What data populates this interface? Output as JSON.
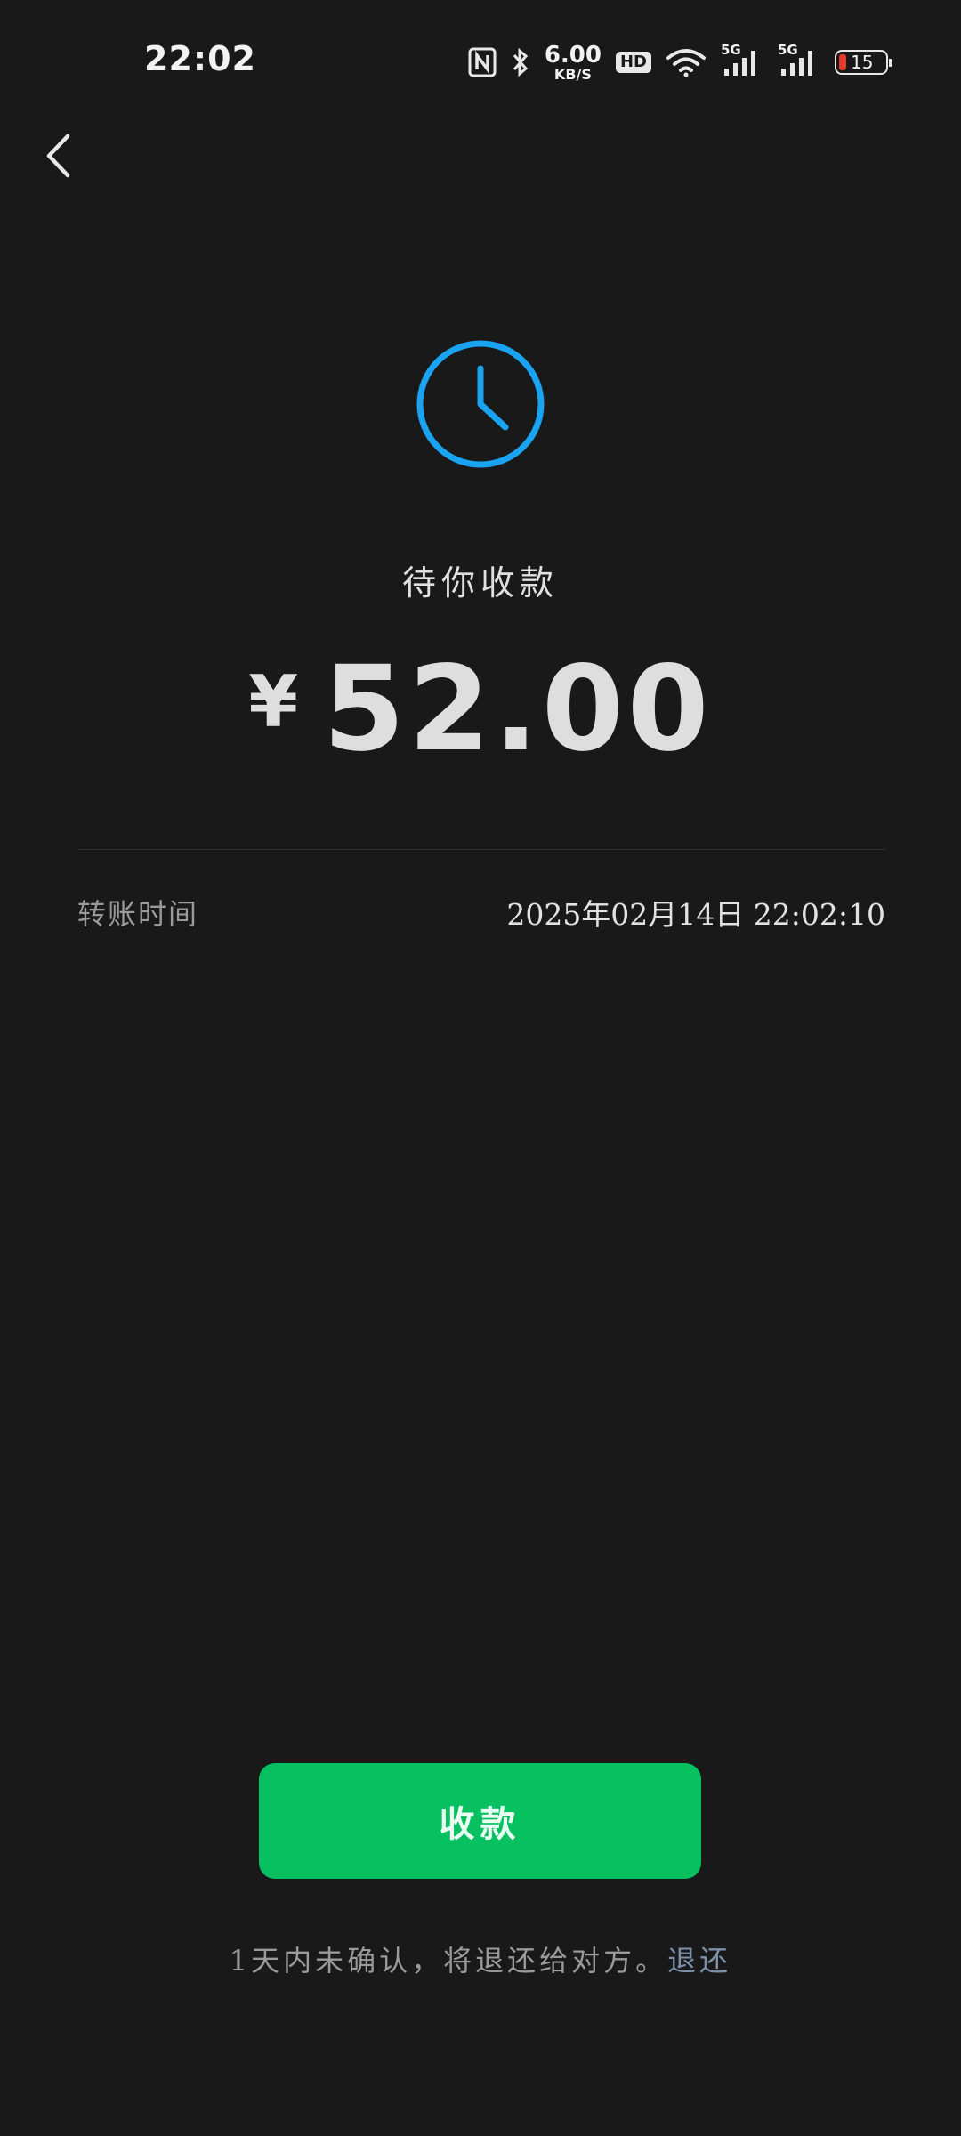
{
  "status_bar": {
    "time": "22:02",
    "net_speed_value": "6.00",
    "net_speed_unit": "KB/S",
    "hd_label": "HD",
    "signal_1_label": "5G",
    "signal_2_label": "5G",
    "battery_level": "15",
    "icons": [
      "nfc-icon",
      "bluetooth-icon",
      "wifi-icon",
      "signal-icon",
      "battery-icon"
    ],
    "battery_low_color": "#e8382e"
  },
  "header": {
    "back_icon": "chevron-left-icon"
  },
  "transfer": {
    "status_icon": "clock-icon",
    "status_icon_color": "#1aa3f0",
    "status_text": "待你收款",
    "currency_symbol": "¥",
    "amount": "52.00",
    "time_label": "转账时间",
    "time_value": "2025年02月14日 22:02:10"
  },
  "actions": {
    "receive_label": "收款",
    "receive_color": "#07c160"
  },
  "footer": {
    "note": "1天内未确认，将退还给对方。",
    "refund_link": "退还"
  }
}
